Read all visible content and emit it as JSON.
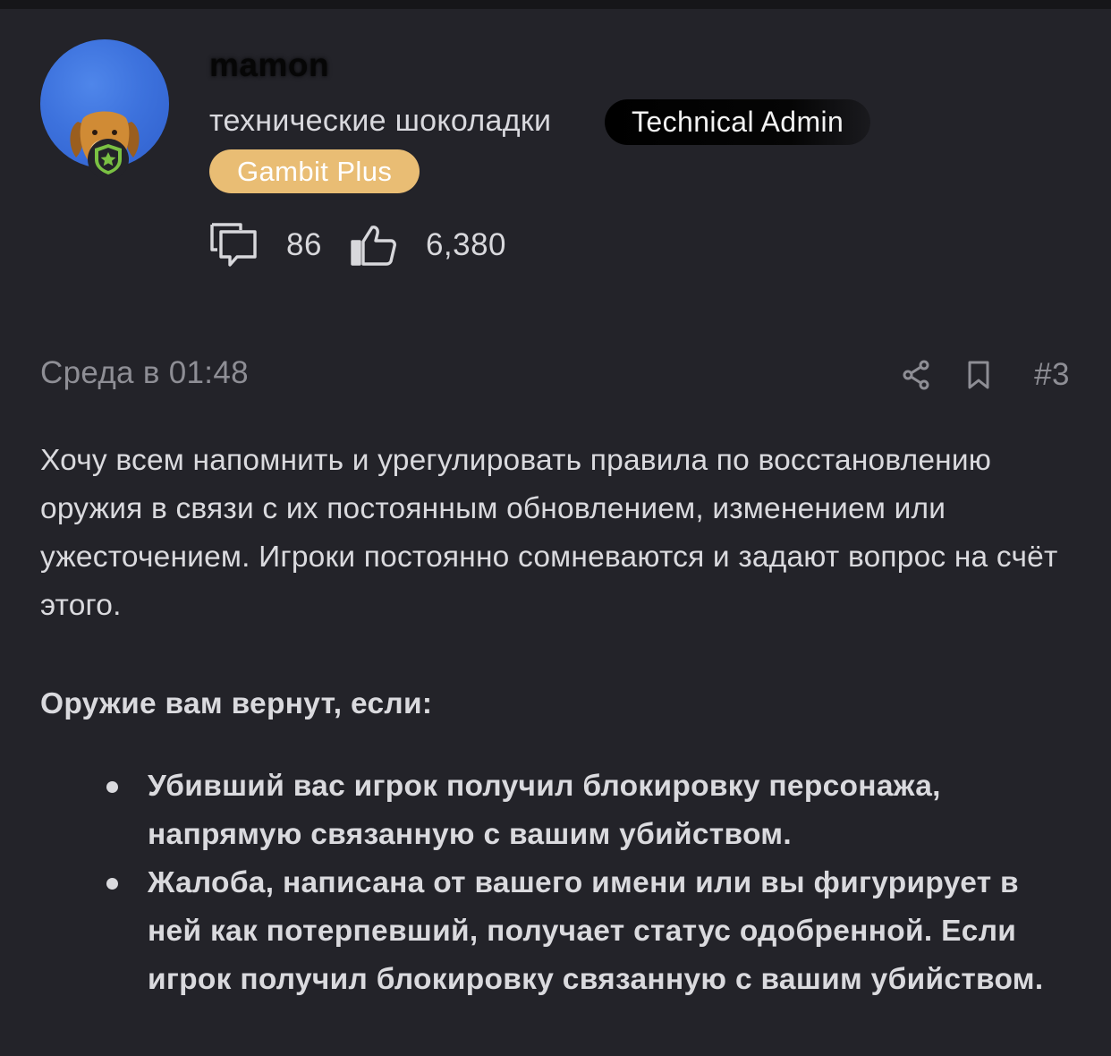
{
  "author": {
    "username": "mamon",
    "user_title": "технические шоколадки",
    "badges": {
      "role": "Technical Admin",
      "subscription": "Gambit Plus"
    },
    "avatar_icon": "dog-avatar-icon",
    "role_icon": "shield-star-icon",
    "stats": {
      "messages_icon": "messages-icon",
      "messages_count": "86",
      "reactions_icon": "thumbs-up-icon",
      "reactions_count": "6,380"
    }
  },
  "post": {
    "timestamp": "Среда в 01:48",
    "share_icon": "share-icon",
    "bookmark_icon": "bookmark-icon",
    "number": "#3",
    "intro": "Хочу всем напомнить и урегулировать правила по восстановлению оружия в связи с их постоянным обновлением, изменением или ужесточением. Игроки постоянно сомневаются и задают вопрос на счёт этого.",
    "heading": "Оружие вам вернут, если:",
    "bullets": [
      "Убивший вас игрок получил блокировку персонажа, напрямую связанную с вашим убийством.",
      "Жалоба, написана от вашего имени или вы фигурирует в ней как потерпевший, получает статус одобренной. Если игрок получил блокировку связанную с вашим убийством."
    ]
  },
  "colors": {
    "page_background": "#161619",
    "card_background": "#232329",
    "text_primary": "#dadade",
    "text_muted": "#8e8e95",
    "admin_badge": "#000000",
    "plus_badge": "#e9bd74",
    "avatar_blue": "#3d72dd",
    "shield_green": "#7ac143"
  }
}
